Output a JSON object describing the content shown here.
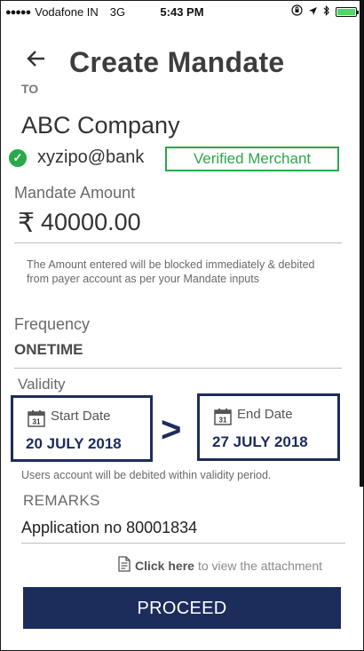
{
  "status_bar": {
    "carrier": "Vodafone IN",
    "network": "3G",
    "time": "5:43 PM"
  },
  "header": {
    "title": "Create Mandate"
  },
  "payee": {
    "to_label": "TO",
    "name": "ABC Company",
    "vpa": "xyzipo@bank",
    "verified_badge": "Verified Merchant"
  },
  "amount": {
    "label": "Mandate Amount",
    "currency_symbol": "₹",
    "value": "40000.00",
    "note": "The Amount entered will be blocked immediately & debited from payer account as per your Mandate inputs"
  },
  "frequency": {
    "label": "Frequency",
    "value": "ONETIME"
  },
  "validity": {
    "label": "Validity",
    "start_label": "Start Date",
    "start_value": "20 JULY 2018",
    "separator": ">",
    "end_label": "End Date",
    "end_value": "27 JULY 2018",
    "note": "Users account will be debited within validity period.",
    "calendar_day": "31"
  },
  "remarks": {
    "label": "REMARKS",
    "value": "Application no 80001834"
  },
  "attachment": {
    "link_text": "Click here",
    "suffix": "to view the attachment"
  },
  "actions": {
    "proceed_label": "PROCEED"
  },
  "colors": {
    "primary": "#1c2d5c",
    "verified_green": "#2aa84a",
    "battery_green": "#4cd964"
  }
}
